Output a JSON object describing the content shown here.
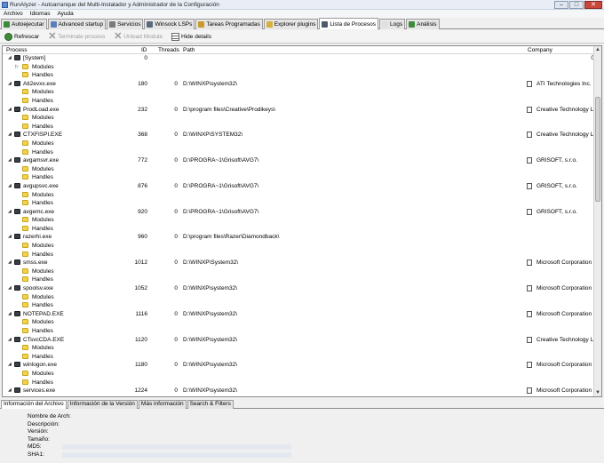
{
  "window": {
    "title": "RunAlyzer - Autoarranque del Multi-Instalador y Administrador de la Configuración",
    "buttons": {
      "minimize": "–",
      "maximize": "□",
      "close": "✕"
    }
  },
  "menu": [
    "Archivo",
    "Idiomas",
    "Ayuda"
  ],
  "tabs": [
    {
      "label": "Autoejecutar",
      "color": "#3f8a3a"
    },
    {
      "label": "Advanced startup",
      "color": "#5a7fb8"
    },
    {
      "label": "Servicios",
      "color": "#7a7a7a"
    },
    {
      "label": "Winsock LSPs",
      "color": "#5a6a7a"
    },
    {
      "label": "Tareas Programadas",
      "color": "#c89a2a"
    },
    {
      "label": "Explorer plugins",
      "color": "#d6b03a"
    },
    {
      "label": "Lista de Procesos",
      "color": "#4a5a6a",
      "active": true
    },
    {
      "label": "Logs",
      "color": "#e0e0e0"
    },
    {
      "label": "Análisis",
      "color": "#3f8a3a"
    }
  ],
  "toolbar": {
    "refresh": "Refrescar",
    "terminate": "Terminate process",
    "unload": "Unload Module",
    "hide_details": "Hide details"
  },
  "columns": {
    "process": "Process",
    "id": "ID",
    "threads": "Threads",
    "path": "Path",
    "company": "Company"
  },
  "rows": [
    {
      "t": "proc",
      "name": "[System]",
      "pid": "0",
      "threads": "",
      "path": "",
      "company": "",
      "extra": "0",
      "expanded": true
    },
    {
      "t": "child",
      "name": "Modules",
      "expander": true
    },
    {
      "t": "child",
      "name": "Handles"
    },
    {
      "t": "proc",
      "name": "Ati2evxx.exe",
      "pid": "180",
      "threads": "0",
      "path": "D:\\WINXP\\system32\\",
      "company": "ATI Technologies Inc."
    },
    {
      "t": "child",
      "name": "Modules"
    },
    {
      "t": "child",
      "name": "Handles"
    },
    {
      "t": "proc",
      "name": "ProdLoad.exe",
      "pid": "232",
      "threads": "0",
      "path": "D:\\program files\\Creative\\Prodikeys\\",
      "company": "Creative Technology Ltd"
    },
    {
      "t": "child",
      "name": "Modules"
    },
    {
      "t": "child",
      "name": "Handles"
    },
    {
      "t": "proc",
      "name": "CTXFISPI.EXE",
      "pid": "368",
      "threads": "0",
      "path": "D:\\WINXP\\SYSTEM32\\",
      "company": "Creative Technology Ltd"
    },
    {
      "t": "child",
      "name": "Modules"
    },
    {
      "t": "child",
      "name": "Handles"
    },
    {
      "t": "proc",
      "name": "avgamsvr.exe",
      "pid": "772",
      "threads": "0",
      "path": "D:\\PROGRA~1\\Grisoft\\AVG7\\",
      "company": "GRISOFT, s.r.o."
    },
    {
      "t": "child",
      "name": "Modules"
    },
    {
      "t": "child",
      "name": "Handles"
    },
    {
      "t": "proc",
      "name": "avgupsvc.exe",
      "pid": "876",
      "threads": "0",
      "path": "D:\\PROGRA~1\\Grisoft\\AVG7\\",
      "company": "GRISOFT, s.r.o."
    },
    {
      "t": "child",
      "name": "Modules"
    },
    {
      "t": "child",
      "name": "Handles"
    },
    {
      "t": "proc",
      "name": "avgemc.exe",
      "pid": "920",
      "threads": "0",
      "path": "D:\\PROGRA~1\\Grisoft\\AVG7\\",
      "company": "GRISOFT, s.r.o."
    },
    {
      "t": "child",
      "name": "Modules"
    },
    {
      "t": "child",
      "name": "Handles"
    },
    {
      "t": "proc",
      "name": "razerhi.exe",
      "pid": "960",
      "threads": "0",
      "path": "D:\\program files\\Razer\\Diamondback\\",
      "company": ""
    },
    {
      "t": "child",
      "name": "Modules"
    },
    {
      "t": "child",
      "name": "Handles"
    },
    {
      "t": "proc",
      "name": "smss.exe",
      "pid": "1012",
      "threads": "0",
      "path": "D:\\WINXP\\System32\\",
      "company": "Microsoft Corporation"
    },
    {
      "t": "child",
      "name": "Modules"
    },
    {
      "t": "child",
      "name": "Handles"
    },
    {
      "t": "proc",
      "name": "spoolsv.exe",
      "pid": "1052",
      "threads": "0",
      "path": "D:\\WINXP\\system32\\",
      "company": "Microsoft Corporation"
    },
    {
      "t": "child",
      "name": "Modules"
    },
    {
      "t": "child",
      "name": "Handles"
    },
    {
      "t": "proc",
      "name": "NOTEPAD.EXE",
      "pid": "1116",
      "threads": "0",
      "path": "D:\\WINXP\\system32\\",
      "company": "Microsoft Corporation"
    },
    {
      "t": "child",
      "name": "Modules"
    },
    {
      "t": "child",
      "name": "Handles"
    },
    {
      "t": "proc",
      "name": "CTsvcCDA.EXE",
      "pid": "1120",
      "threads": "0",
      "path": "D:\\WINXP\\system32\\",
      "company": "Creative Technology Ltd"
    },
    {
      "t": "child",
      "name": "Modules"
    },
    {
      "t": "child",
      "name": "Handles"
    },
    {
      "t": "proc",
      "name": "winlogon.exe",
      "pid": "1180",
      "threads": "0",
      "path": "D:\\WINXP\\system32\\",
      "company": "Microsoft Corporation"
    },
    {
      "t": "child",
      "name": "Modules"
    },
    {
      "t": "child",
      "name": "Handles"
    },
    {
      "t": "proc",
      "name": "services.exe",
      "pid": "1224",
      "threads": "0",
      "path": "D:\\WINXP\\system32\\",
      "company": "Microsoft Corporation"
    }
  ],
  "bottom_tabs": [
    {
      "label": "Información del Archivo",
      "active": true
    },
    {
      "label": "Información de la Versión"
    },
    {
      "label": "Más información"
    },
    {
      "label": "Search & Filters"
    }
  ],
  "info": {
    "fields": [
      {
        "label": "Nombre de Arch:",
        "value": ""
      },
      {
        "label": "Descripción:",
        "value": ""
      },
      {
        "label": "Versión:",
        "value": ""
      },
      {
        "label": "Tamaño:",
        "value": ""
      },
      {
        "label": "MD5:",
        "value": ""
      },
      {
        "label": "SHA1:",
        "value": ""
      }
    ]
  }
}
